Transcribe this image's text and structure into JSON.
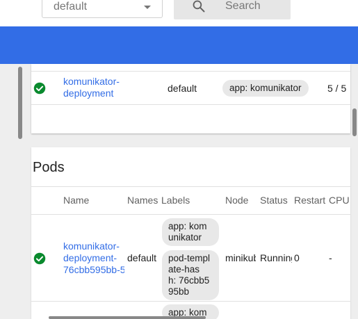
{
  "toolbar": {
    "namespace_value": "default",
    "search_placeholder": "Search"
  },
  "deployments": {
    "row": {
      "name": "komunikator-\ndeployment",
      "namespace": "default",
      "label": "app: komunikator",
      "pods": "5 / 5"
    }
  },
  "pods": {
    "title": "Pods",
    "columns": [
      "Name",
      "Names",
      "Labels",
      "Node",
      "Status",
      "Restart",
      "CPU"
    ],
    "rows": [
      {
        "name": "komunikator-\ndeployment-\n76cbb595bb-5",
        "namespace": "default",
        "labels": [
          "app: kom\nunikator",
          "pod-templ\nate-has\nh: 76cbb5\n95bb"
        ],
        "node": "minikub",
        "status": "Running",
        "restarts": "0",
        "cpu": "-"
      },
      {
        "labels": [
          "app: kom"
        ]
      }
    ]
  },
  "colors": {
    "accent": "#326de6",
    "success": "#0a8a2e"
  }
}
